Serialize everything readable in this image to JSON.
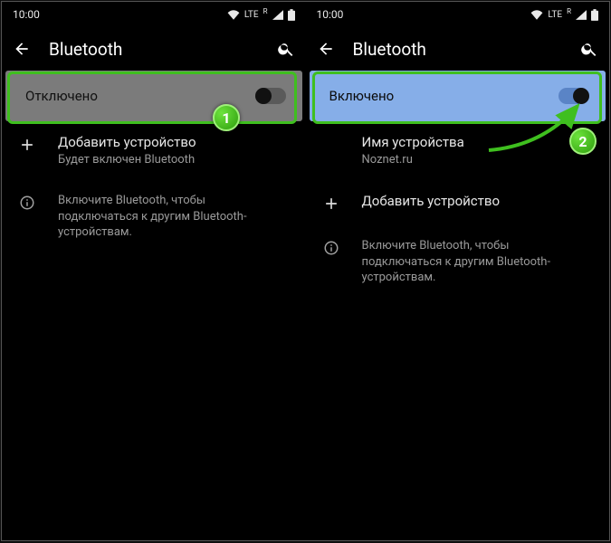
{
  "left": {
    "status": {
      "time": "10:00",
      "net": "LTE",
      "r": "R"
    },
    "header": {
      "title": "Bluetooth"
    },
    "toggle": {
      "label": "Отключено",
      "on": false
    },
    "add": {
      "title": "Добавить устройство",
      "sub": "Будет включен Bluetooth"
    },
    "info": {
      "text": "Включите Bluetooth, чтобы подключаться к другим Bluetooth-устройствам."
    }
  },
  "right": {
    "status": {
      "time": "10:00",
      "net": "LTE",
      "r": "R"
    },
    "header": {
      "title": "Bluetooth"
    },
    "toggle": {
      "label": "Включено",
      "on": true
    },
    "devicename": {
      "title": "Имя устройства",
      "sub": "Noznet.ru"
    },
    "add": {
      "title": "Добавить устройство"
    },
    "info": {
      "text": "Включите Bluetooth, чтобы подключаться к другим Bluetooth-устройствам."
    }
  },
  "badges": {
    "one": "1",
    "two": "2"
  }
}
